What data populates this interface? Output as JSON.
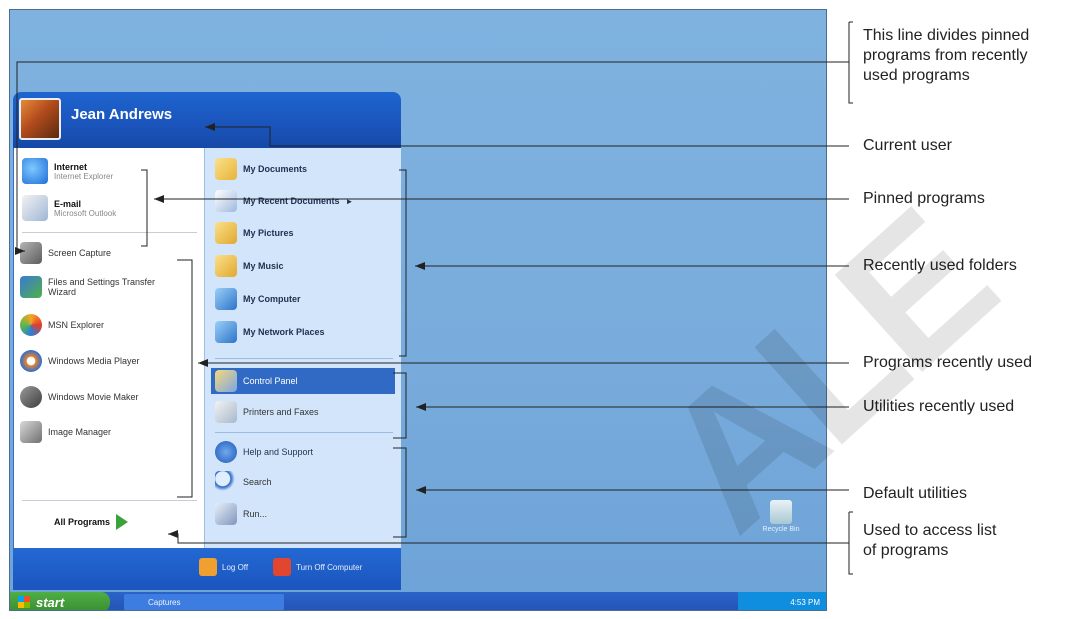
{
  "start_menu": {
    "user_name": "Jean Andrews",
    "pinned": [
      {
        "title": "Internet",
        "subtitle": "Internet Explorer",
        "icon": "internet-explorer-icon"
      },
      {
        "title": "E-mail",
        "subtitle": "Microsoft Outlook",
        "icon": "outlook-icon"
      }
    ],
    "recent_programs": [
      {
        "label": "Screen Capture",
        "icon": "screen-capture-icon"
      },
      {
        "label": "Files and Settings Transfer Wizard",
        "icon": "transfer-wizard-icon"
      },
      {
        "label": "MSN Explorer",
        "icon": "msn-butterfly-icon"
      },
      {
        "label": "Windows Media Player",
        "icon": "media-player-icon"
      },
      {
        "label": "Windows Movie Maker",
        "icon": "movie-maker-icon"
      },
      {
        "label": "Image Manager",
        "icon": "image-manager-icon"
      }
    ],
    "all_programs": "All Programs",
    "folders": [
      {
        "label": "My Documents",
        "icon": "folder-documents-icon"
      },
      {
        "label": "My Recent Documents",
        "icon": "recent-documents-icon",
        "has_submenu": true
      },
      {
        "label": "My Pictures",
        "icon": "folder-pictures-icon"
      },
      {
        "label": "My Music",
        "icon": "folder-music-icon"
      },
      {
        "label": "My Computer",
        "icon": "computer-icon"
      },
      {
        "label": "My Network Places",
        "icon": "network-icon"
      }
    ],
    "utilities": [
      {
        "label": "Control Panel",
        "icon": "control-panel-icon",
        "highlighted": true
      },
      {
        "label": "Printers and Faxes",
        "icon": "printer-icon"
      }
    ],
    "defaults": [
      {
        "label": "Help and Support",
        "icon": "help-icon"
      },
      {
        "label": "Search",
        "icon": "search-icon"
      },
      {
        "label": "Run...",
        "icon": "run-icon"
      }
    ],
    "log_off": "Log Off",
    "turn_off": "Turn Off Computer"
  },
  "taskbar": {
    "start_label": "start",
    "task_item": "Captures",
    "clock": "4:53 PM"
  },
  "desktop": {
    "recycle_bin": "Recycle Bin"
  },
  "annotations": {
    "divider_line": [
      "This line divides pinned",
      "programs from recently",
      "used programs"
    ],
    "current_user": "Current user",
    "pinned_programs": "Pinned programs",
    "recent_folders": "Recently used folders",
    "programs_recent": "Programs recently used",
    "utilities_recent": "Utilities recently used",
    "default_utilities": "Default utilities",
    "access_programs": [
      "Used to access list",
      "of programs"
    ]
  },
  "colors": {
    "desktop": "#7fb2df",
    "menu_blue": "#1e64cf",
    "right_pane": "#d3e5fa",
    "highlight": "#316ac5",
    "start_green": "#3a8e32"
  }
}
